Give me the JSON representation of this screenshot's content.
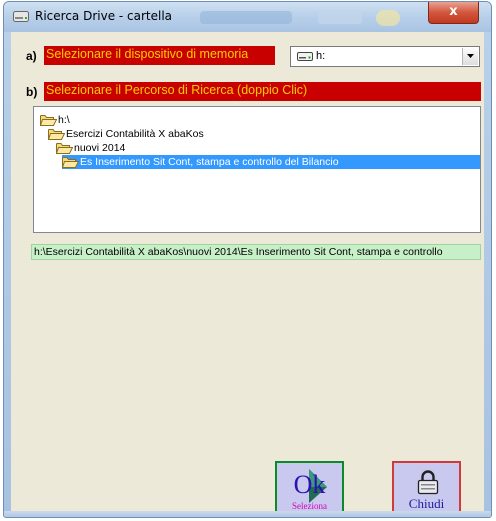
{
  "window": {
    "title": "Ricerca Drive - cartella",
    "close_glyph": "x"
  },
  "step_a": {
    "letter": "a)",
    "label": "Selezionare il dispositivo di memoria"
  },
  "drive_select": {
    "value": "h:",
    "icon": "drive-icon"
  },
  "step_b": {
    "letter": "b)",
    "label": "Selezionare il Percorso di Ricerca (doppio Clic)"
  },
  "tree": {
    "items": [
      {
        "label": "h:\\",
        "icon": "folder-open-icon"
      },
      {
        "label": "Esercizi Contabilità X abaKos",
        "icon": "folder-open-icon"
      },
      {
        "label": "nuovi 2014",
        "icon": "folder-open-icon"
      },
      {
        "label": "Es Inserimento Sit Cont, stampa e controllo del Bilancio",
        "icon": "folder-open-icon",
        "selected": true
      }
    ]
  },
  "path_display": "h:\\Esercizi Contabilità X abaKos\\nuovi 2014\\Es Inserimento Sit Cont, stampa e controllo",
  "buttons": {
    "ok": {
      "main": "Ok",
      "sub": "Seleziona"
    },
    "close": {
      "label": "Chiudi",
      "icon": "padlock-icon"
    }
  },
  "colors": {
    "label_bg": "#c80000",
    "label_fg": "#ffcc00",
    "selection": "#3399ff",
    "path_bg": "#c8f0c8",
    "button_bg": "#c9c8ee"
  }
}
